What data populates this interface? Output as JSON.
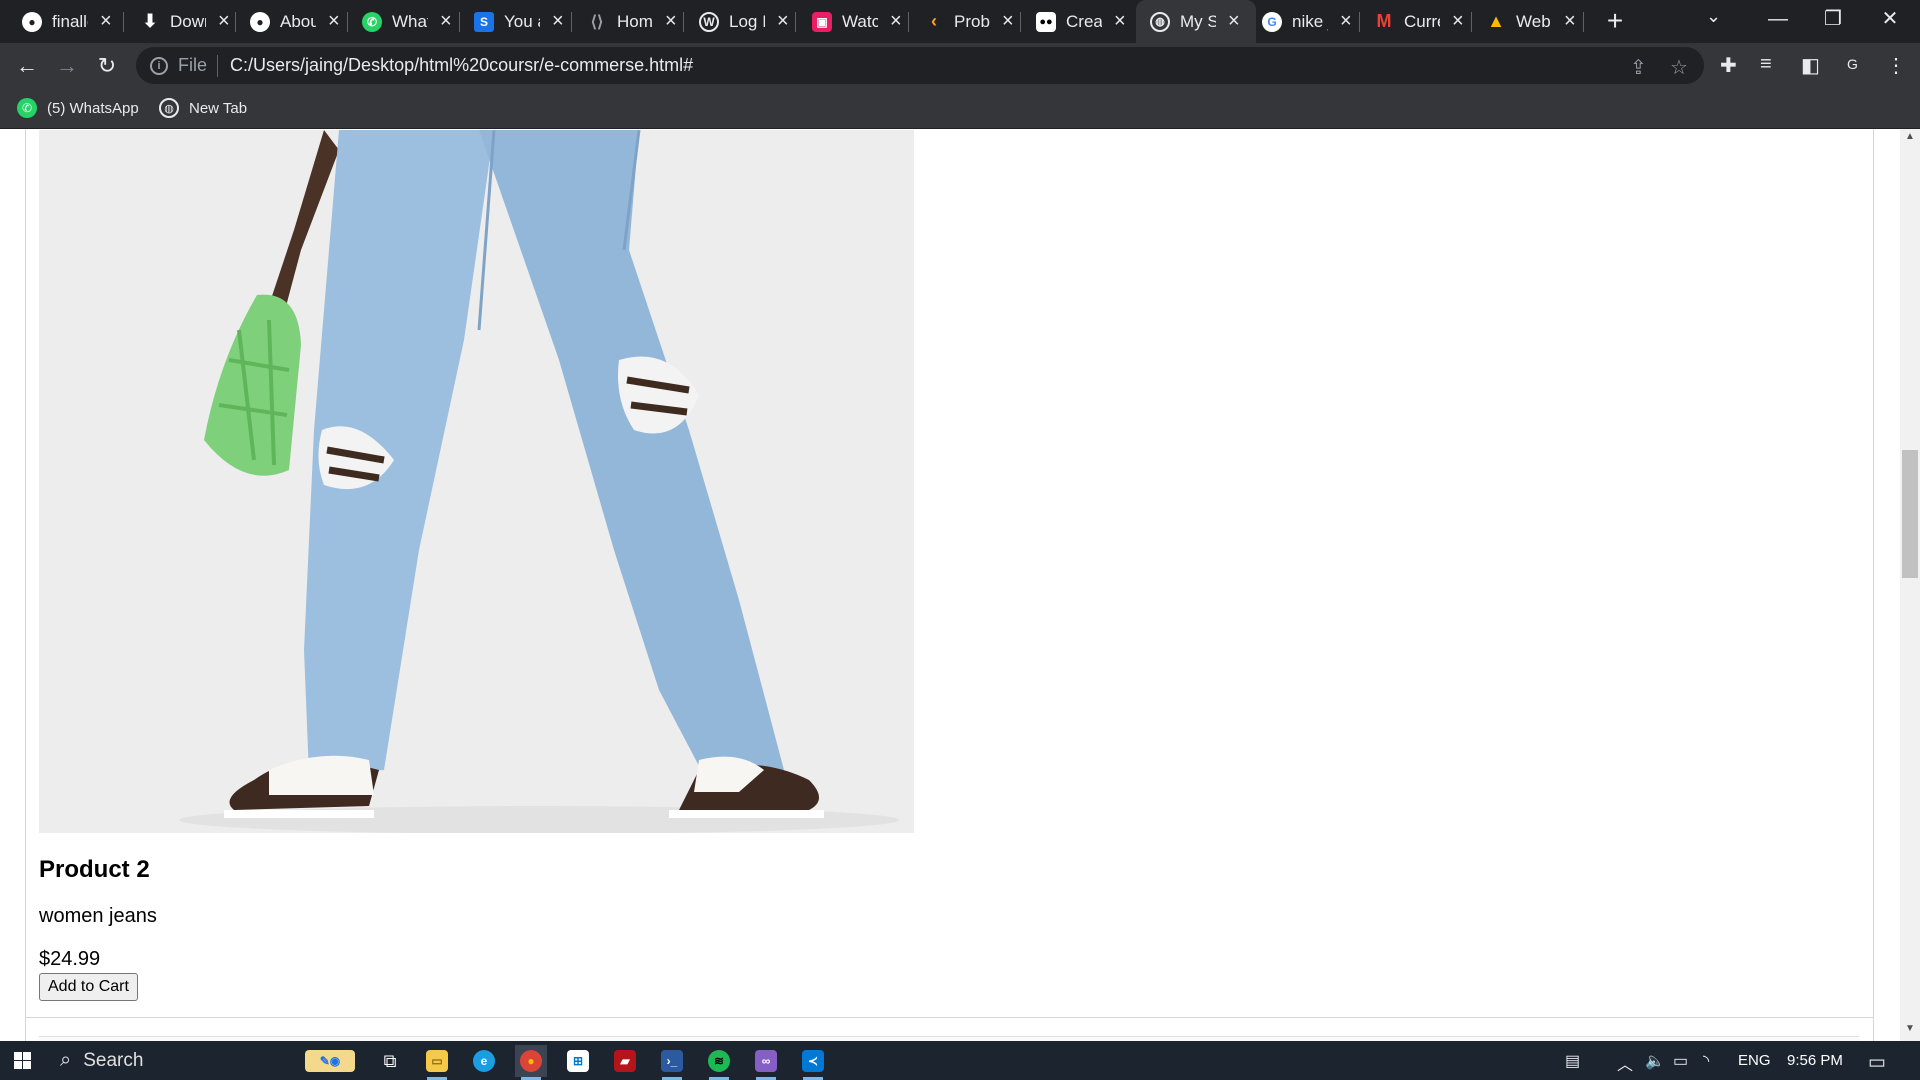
{
  "browser": {
    "tabs": [
      {
        "title": "finalle",
        "icon": "github-icon",
        "color": "#ffffff"
      },
      {
        "title": "Download",
        "icon": "download-icon",
        "color": "#ffffff"
      },
      {
        "title": "About",
        "icon": "github-icon",
        "color": "#ffffff"
      },
      {
        "title": "WhatsApp",
        "icon": "whatsapp-icon",
        "color": "#25d366"
      },
      {
        "title": "You are",
        "icon": "s-logo-icon",
        "color": "#1a73e8"
      },
      {
        "title": "Home",
        "icon": "bracket-logo-icon",
        "color": "#9aa0a6"
      },
      {
        "title": "Log In",
        "icon": "wordpress-icon",
        "color": "#e8eaed"
      },
      {
        "title": "Watch",
        "icon": "tv-icon",
        "color": "#e91e63"
      },
      {
        "title": "Problems",
        "icon": "leetcode-icon",
        "color": "#ffa116"
      },
      {
        "title": "Create",
        "icon": "medium-icon",
        "color": "#ffffff"
      },
      {
        "title": "My Store",
        "icon": "globe-icon",
        "color": "#e8eaed",
        "active": true
      },
      {
        "title": "nike jeans",
        "icon": "google-icon",
        "color": "#4285f4"
      },
      {
        "title": "Current",
        "icon": "gmail-icon",
        "color": "#ea4335"
      },
      {
        "title": "Web",
        "icon": "drive-icon",
        "color": "#fbbc04"
      }
    ],
    "url_scheme_label": "File",
    "url": "C:/Users/jaing/Desktop/html%20coursr/e-commerse.html#",
    "profile_initial": "G",
    "bookmarks": [
      {
        "label": "(5) WhatsApp",
        "icon": "whatsapp-icon"
      },
      {
        "label": "New Tab",
        "icon": "globe-icon"
      }
    ]
  },
  "page": {
    "product": {
      "name": "Product 2",
      "description": "women jeans",
      "price": "$24.99",
      "button_label": "Add to Cart"
    }
  },
  "taskbar": {
    "search_label": "Search",
    "language": "ENG",
    "time": "9:56 PM"
  }
}
